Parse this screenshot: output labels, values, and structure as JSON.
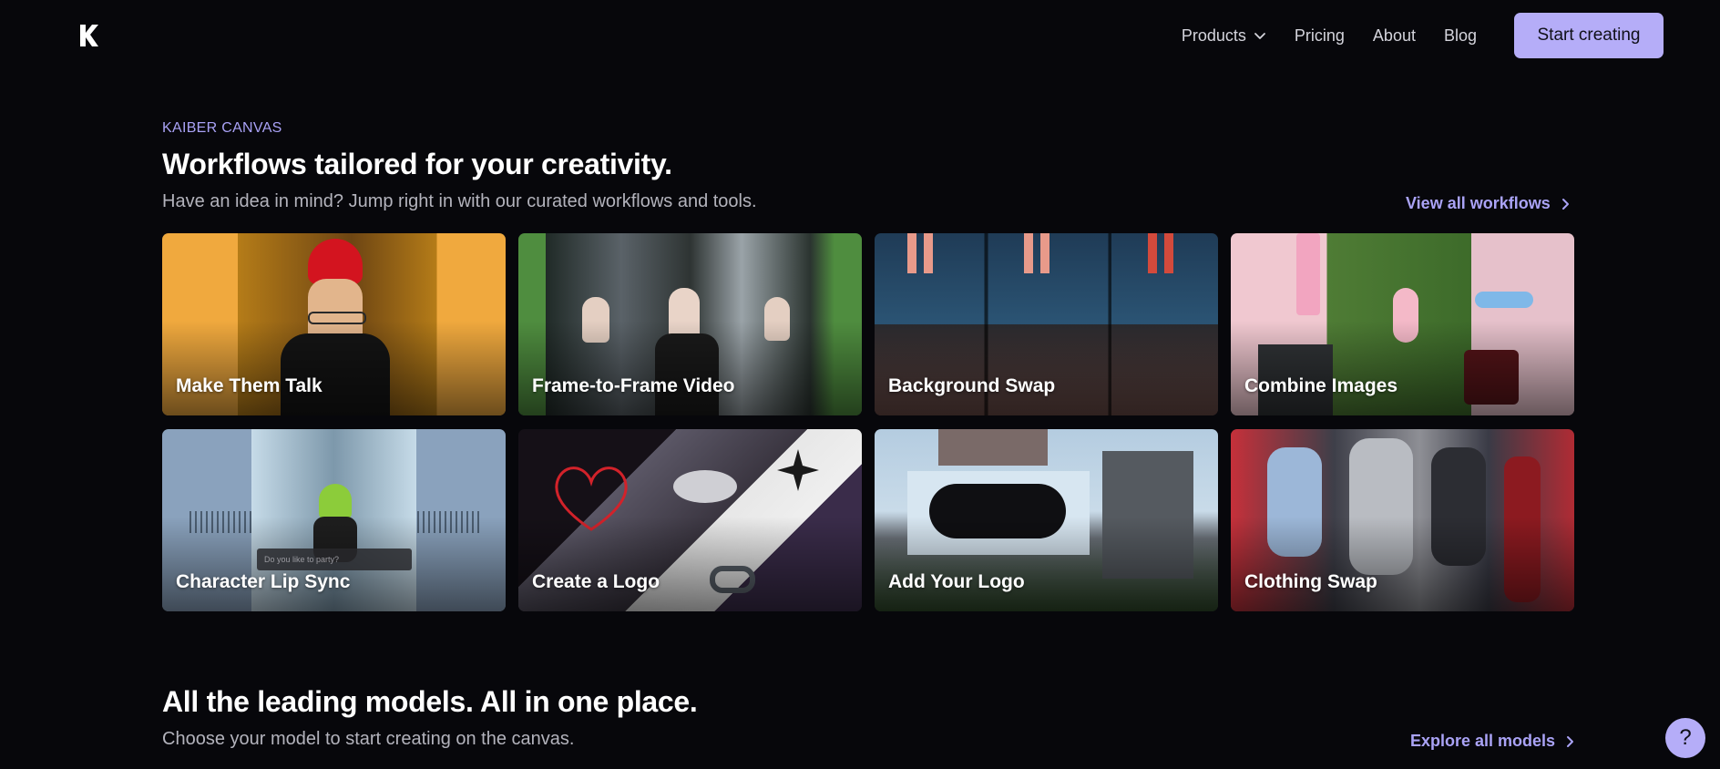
{
  "header": {
    "nav": [
      {
        "label": "Products",
        "has_dropdown": true
      },
      {
        "label": "Pricing"
      },
      {
        "label": "About"
      },
      {
        "label": "Blog"
      }
    ],
    "cta_label": "Start creating"
  },
  "workflows": {
    "eyebrow": "KAIBER CANVAS",
    "title": "Workflows tailored for your creativity.",
    "subtitle": "Have an idea in mind? Jump right in with our curated workflows and tools.",
    "view_all": "View all workflows",
    "cards": [
      {
        "label": "Make Them Talk"
      },
      {
        "label": "Frame-to-Frame Video"
      },
      {
        "label": "Background Swap"
      },
      {
        "label": "Combine Images"
      },
      {
        "label": "Character Lip Sync",
        "overlay_text": "Do you like to party?"
      },
      {
        "label": "Create a Logo"
      },
      {
        "label": "Add Your Logo"
      },
      {
        "label": "Clothing Swap"
      }
    ]
  },
  "models": {
    "title": "All the leading models. All in one place.",
    "subtitle": "Choose your model to start creating on the canvas.",
    "explore": "Explore all models"
  },
  "help_label": "?",
  "colors": {
    "background": "#07070b",
    "accent": "#b5adf8",
    "link": "#aaa3f6"
  }
}
